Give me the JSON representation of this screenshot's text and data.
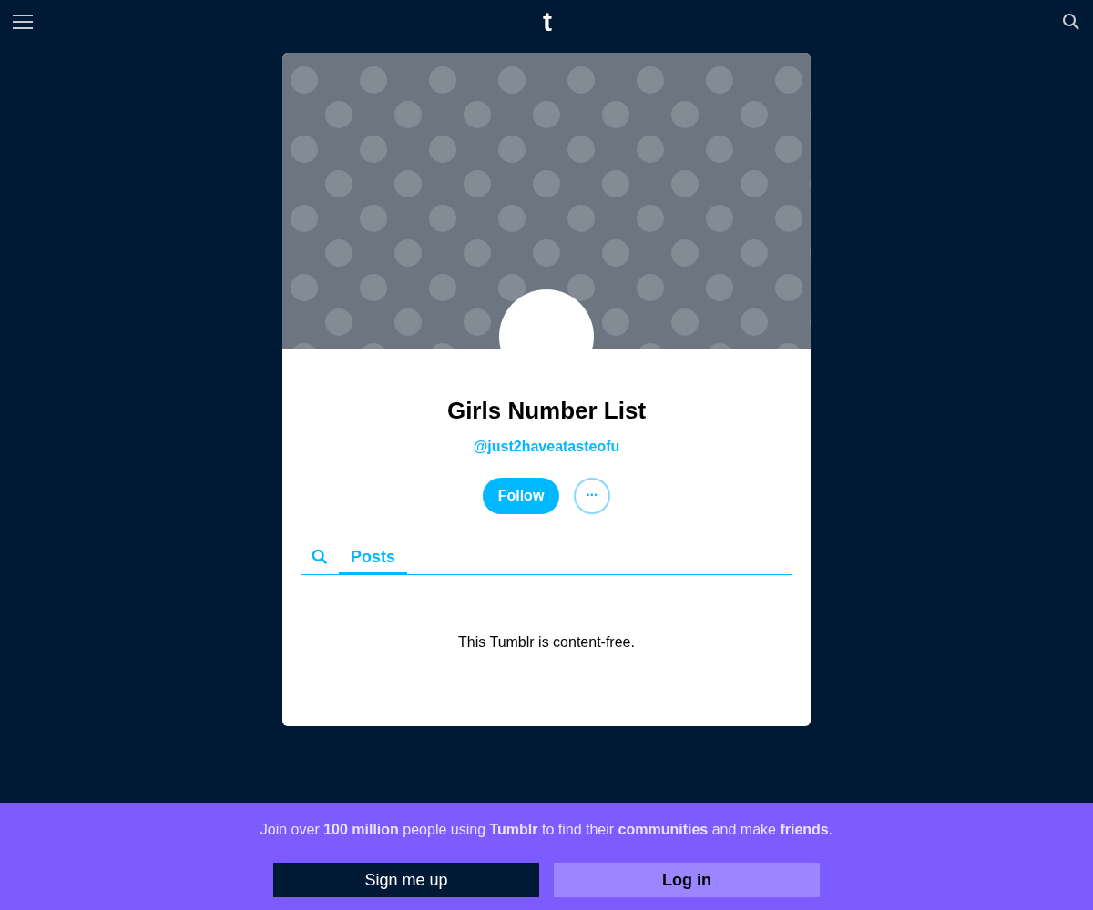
{
  "top_bar": {
    "logo": "t"
  },
  "blog": {
    "title": "Girls Number List",
    "handle": "@just2haveatasteofu",
    "follow_button": "Follow",
    "more_button": "•••"
  },
  "tabs": [
    {
      "kind": "search",
      "selected": false
    },
    {
      "kind": "label",
      "label": "Posts",
      "selected": true
    }
  ],
  "empty_message": "This Tumblr is content-free.",
  "signup_banner": {
    "text": "Join over **100 million** people using **Tumblr** to find their **communities** and make **friends**.",
    "buttons": [
      {
        "label": "Sign me up",
        "kind": "dark"
      },
      {
        "label": "Log in",
        "kind": "light"
      }
    ]
  }
}
